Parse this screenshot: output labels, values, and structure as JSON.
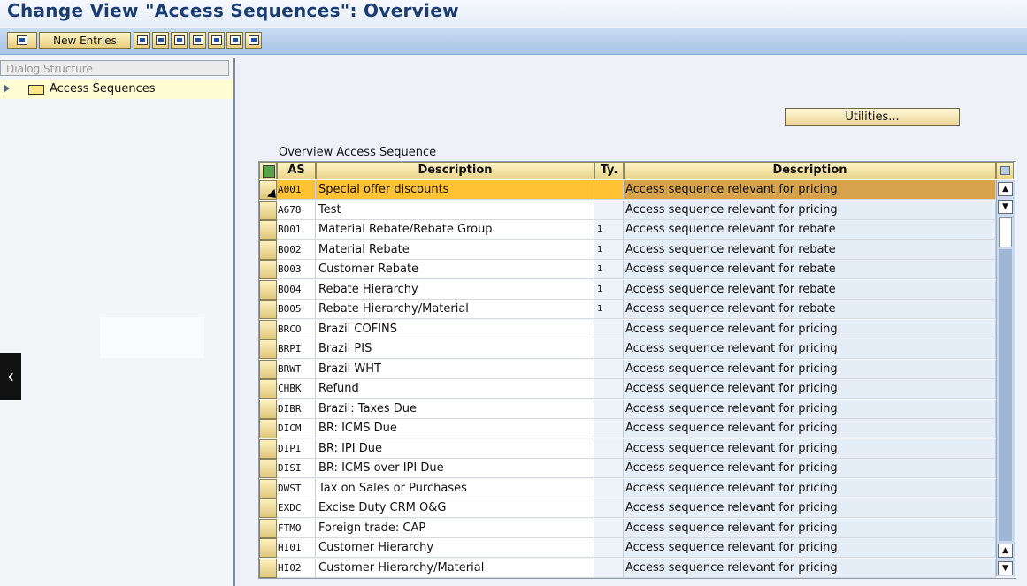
{
  "window": {
    "title": "Change View \"Access Sequences\": Overview"
  },
  "toolbar": {
    "new_entries": "New Entries"
  },
  "dialog_structure": {
    "header": "Dialog Structure",
    "node": "Access Sequences"
  },
  "utilities": {
    "label": "Utilities..."
  },
  "overview": {
    "title": "Overview Access Sequence",
    "columns": [
      "AS",
      "Description",
      "Ty.",
      "Description"
    ],
    "rows": [
      {
        "as": "A001",
        "desc": "Special offer discounts",
        "ty": "",
        "desc2": "Access sequence relevant for pricing"
      },
      {
        "as": "A678",
        "desc": "Test",
        "ty": "",
        "desc2": "Access sequence relevant for pricing"
      },
      {
        "as": "BO01",
        "desc": "Material Rebate/Rebate Group",
        "ty": "1",
        "desc2": "Access sequence relevant for rebate"
      },
      {
        "as": "BO02",
        "desc": "Material Rebate",
        "ty": "1",
        "desc2": "Access sequence relevant for rebate"
      },
      {
        "as": "BO03",
        "desc": "Customer Rebate",
        "ty": "1",
        "desc2": "Access sequence relevant for rebate"
      },
      {
        "as": "BO04",
        "desc": "Rebate Hierarchy",
        "ty": "1",
        "desc2": "Access sequence relevant for rebate"
      },
      {
        "as": "BO05",
        "desc": "Rebate Hierarchy/Material",
        "ty": "1",
        "desc2": "Access sequence relevant for rebate"
      },
      {
        "as": "BRCO",
        "desc": "Brazil COFINS",
        "ty": "",
        "desc2": "Access sequence relevant for pricing"
      },
      {
        "as": "BRPI",
        "desc": "Brazil PIS",
        "ty": "",
        "desc2": "Access sequence relevant for pricing"
      },
      {
        "as": "BRWT",
        "desc": "Brazil WHT",
        "ty": "",
        "desc2": "Access sequence relevant for pricing"
      },
      {
        "as": "CHBK",
        "desc": "Refund",
        "ty": "",
        "desc2": "Access sequence relevant for pricing"
      },
      {
        "as": "DIBR",
        "desc": "Brazil: Taxes Due",
        "ty": "",
        "desc2": "Access sequence relevant for pricing"
      },
      {
        "as": "DICM",
        "desc": "BR: ICMS Due",
        "ty": "",
        "desc2": "Access sequence relevant for pricing"
      },
      {
        "as": "DIPI",
        "desc": "BR: IPI Due",
        "ty": "",
        "desc2": "Access sequence relevant for pricing"
      },
      {
        "as": "DISI",
        "desc": "BR: ICMS over IPI Due",
        "ty": "",
        "desc2": "Access sequence relevant for pricing"
      },
      {
        "as": "DWST",
        "desc": "Tax on Sales or Purchases",
        "ty": "",
        "desc2": "Access sequence relevant for pricing"
      },
      {
        "as": "EXDC",
        "desc": "Excise Duty CRM O&G",
        "ty": "",
        "desc2": "Access sequence relevant for pricing"
      },
      {
        "as": "FTMO",
        "desc": "Foreign trade: CAP",
        "ty": "",
        "desc2": "Access sequence relevant for pricing"
      },
      {
        "as": "HI01",
        "desc": "Customer Hierarchy",
        "ty": "",
        "desc2": "Access sequence relevant for pricing"
      },
      {
        "as": "HI02",
        "desc": "Customer Hierarchy/Material",
        "ty": "",
        "desc2": "Access sequence relevant for pricing"
      }
    ]
  }
}
